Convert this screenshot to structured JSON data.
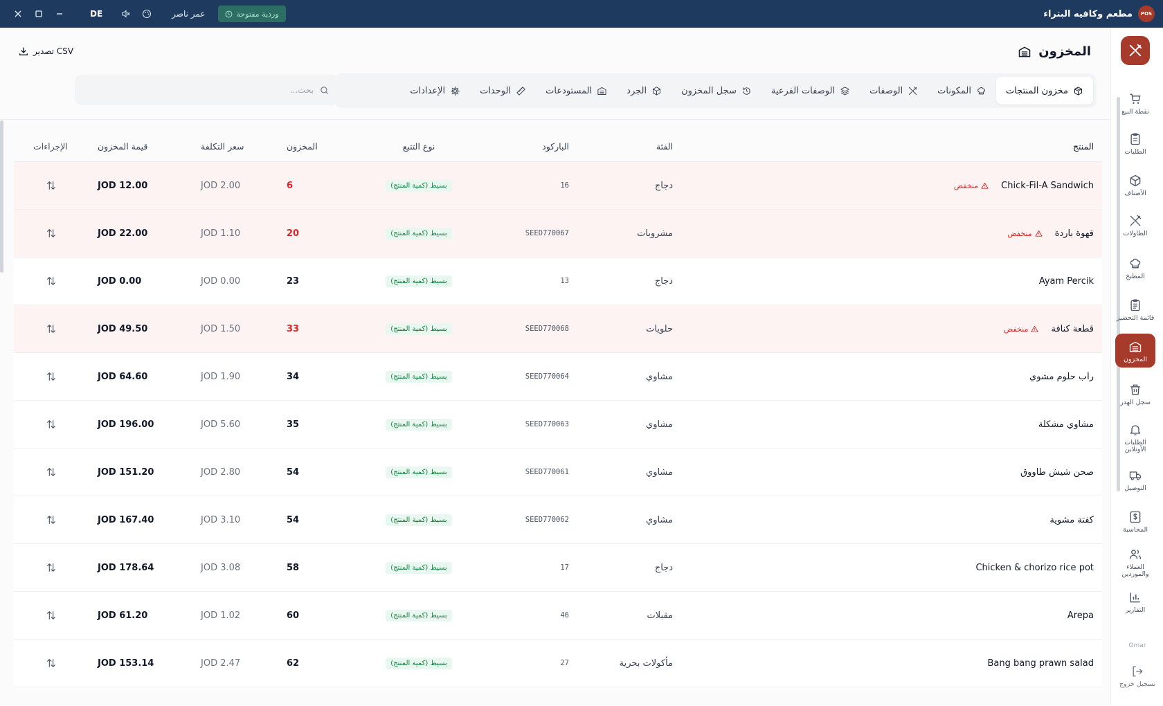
{
  "titlebar": {
    "app_name": "مطعم وكافيه البتراء",
    "logo_text": "POS",
    "shift_status": "وردية مفتوحة",
    "user_name": "عمر ناصر",
    "language": "DE"
  },
  "sidebar": {
    "items": [
      {
        "label": "نقطة البيع",
        "icon": "cart-icon"
      },
      {
        "label": "الطلبات",
        "icon": "clipboard-icon"
      },
      {
        "label": "الأصناف",
        "icon": "box-icon"
      },
      {
        "label": "الطاولات",
        "icon": "utensils-icon"
      },
      {
        "label": "المطبخ",
        "icon": "chef-hat-icon"
      },
      {
        "label": "قائمة التحضير",
        "icon": "checklist-icon"
      },
      {
        "label": "المخزون",
        "icon": "warehouse-icon",
        "active": true
      },
      {
        "label": "سجل الهدر",
        "icon": "trash-icon"
      },
      {
        "label": "الطلبات الأونلاين",
        "icon": "bell-icon"
      },
      {
        "label": "التوصيل",
        "icon": "truck-icon"
      },
      {
        "label": "المحاسبة",
        "icon": "dollar-icon"
      },
      {
        "label": "العملاء والموردين",
        "icon": "users-icon"
      },
      {
        "label": "التقارير",
        "icon": "bar-chart-icon"
      }
    ],
    "user": "Omar",
    "logout": "تسجيل خروج"
  },
  "page": {
    "title": "المخزون",
    "export_label": "تصدير CSV",
    "search_placeholder": "بحث..."
  },
  "tabs": [
    {
      "label": "مخزون المنتجات",
      "icon": "package-icon",
      "active": true
    },
    {
      "label": "المكونات",
      "icon": "chef-hat-icon"
    },
    {
      "label": "الوصفات",
      "icon": "utensils-icon"
    },
    {
      "label": "الوصفات الفرعية",
      "icon": "layers-icon"
    },
    {
      "label": "سجل المخزون",
      "icon": "history-icon"
    },
    {
      "label": "الجرد",
      "icon": "box-icon"
    },
    {
      "label": "المستودعات",
      "icon": "warehouse-icon"
    },
    {
      "label": "الوحدات",
      "icon": "ruler-icon"
    },
    {
      "label": "الإعدادات",
      "icon": "gear-icon"
    }
  ],
  "table": {
    "headers": {
      "product": "المنتج",
      "category": "الفئة",
      "barcode": "الباركود",
      "tracking": "نوع التتبع",
      "stock": "المخزون",
      "cost": "سعر التكلفة",
      "value": "قيمة المخزون",
      "actions": "الإجراءات"
    },
    "low_label": "منخفض",
    "rows": [
      {
        "product": "Chick-Fil-A Sandwich",
        "low": true,
        "category": "دجاج",
        "barcode": "16",
        "tracking": "بسيط (كمية المنتج)",
        "stock": "6",
        "cost": "JOD 2.00",
        "value": "JOD 12.00"
      },
      {
        "product": "قهوة باردة",
        "low": true,
        "category": "مشروبات",
        "barcode": "SEED770067",
        "tracking": "بسيط (كمية المنتج)",
        "stock": "20",
        "cost": "JOD 1.10",
        "value": "JOD 22.00"
      },
      {
        "product": "Ayam Percik",
        "low": false,
        "category": "دجاج",
        "barcode": "13",
        "tracking": "بسيط (كمية المنتج)",
        "stock": "23",
        "cost": "JOD 0.00",
        "value": "JOD 0.00"
      },
      {
        "product": "قطعة كنافة",
        "low": true,
        "category": "حلويات",
        "barcode": "SEED770068",
        "tracking": "بسيط (كمية المنتج)",
        "stock": "33",
        "cost": "JOD 1.50",
        "value": "JOD 49.50"
      },
      {
        "product": "راب حلوم مشوي",
        "low": false,
        "category": "مشاوي",
        "barcode": "SEED770064",
        "tracking": "بسيط (كمية المنتج)",
        "stock": "34",
        "cost": "JOD 1.90",
        "value": "JOD 64.60"
      },
      {
        "product": "مشاوي مشكلة",
        "low": false,
        "category": "مشاوي",
        "barcode": "SEED770063",
        "tracking": "بسيط (كمية المنتج)",
        "stock": "35",
        "cost": "JOD 5.60",
        "value": "JOD 196.00"
      },
      {
        "product": "صحن شيش طاووق",
        "low": false,
        "category": "مشاوي",
        "barcode": "SEED770061",
        "tracking": "بسيط (كمية المنتج)",
        "stock": "54",
        "cost": "JOD 2.80",
        "value": "JOD 151.20"
      },
      {
        "product": "كفتة مشوية",
        "low": false,
        "category": "مشاوي",
        "barcode": "SEED770062",
        "tracking": "بسيط (كمية المنتج)",
        "stock": "54",
        "cost": "JOD 3.10",
        "value": "JOD 167.40"
      },
      {
        "product": "Chicken & chorizo rice pot",
        "low": false,
        "category": "دجاج",
        "barcode": "17",
        "tracking": "بسيط (كمية المنتج)",
        "stock": "58",
        "cost": "JOD 3.08",
        "value": "JOD 178.64"
      },
      {
        "product": "Arepa",
        "low": false,
        "category": "مقبلات",
        "barcode": "46",
        "tracking": "بسيط (كمية المنتج)",
        "stock": "60",
        "cost": "JOD 1.02",
        "value": "JOD 61.20"
      },
      {
        "product": "Bang bang prawn salad",
        "low": false,
        "category": "مأكولات بحرية",
        "barcode": "27",
        "tracking": "بسيط (كمية المنتج)",
        "stock": "62",
        "cost": "JOD 2.47",
        "value": "JOD 153.14"
      }
    ]
  },
  "colors": {
    "titlebar": "#1e3a5f",
    "brand": "#a63a2b",
    "low_stock": "#dc2626",
    "low_row_bg": "#fdf3f3",
    "tracking_badge_bg": "#e8f7ef",
    "tracking_badge_fg": "#15803d"
  }
}
